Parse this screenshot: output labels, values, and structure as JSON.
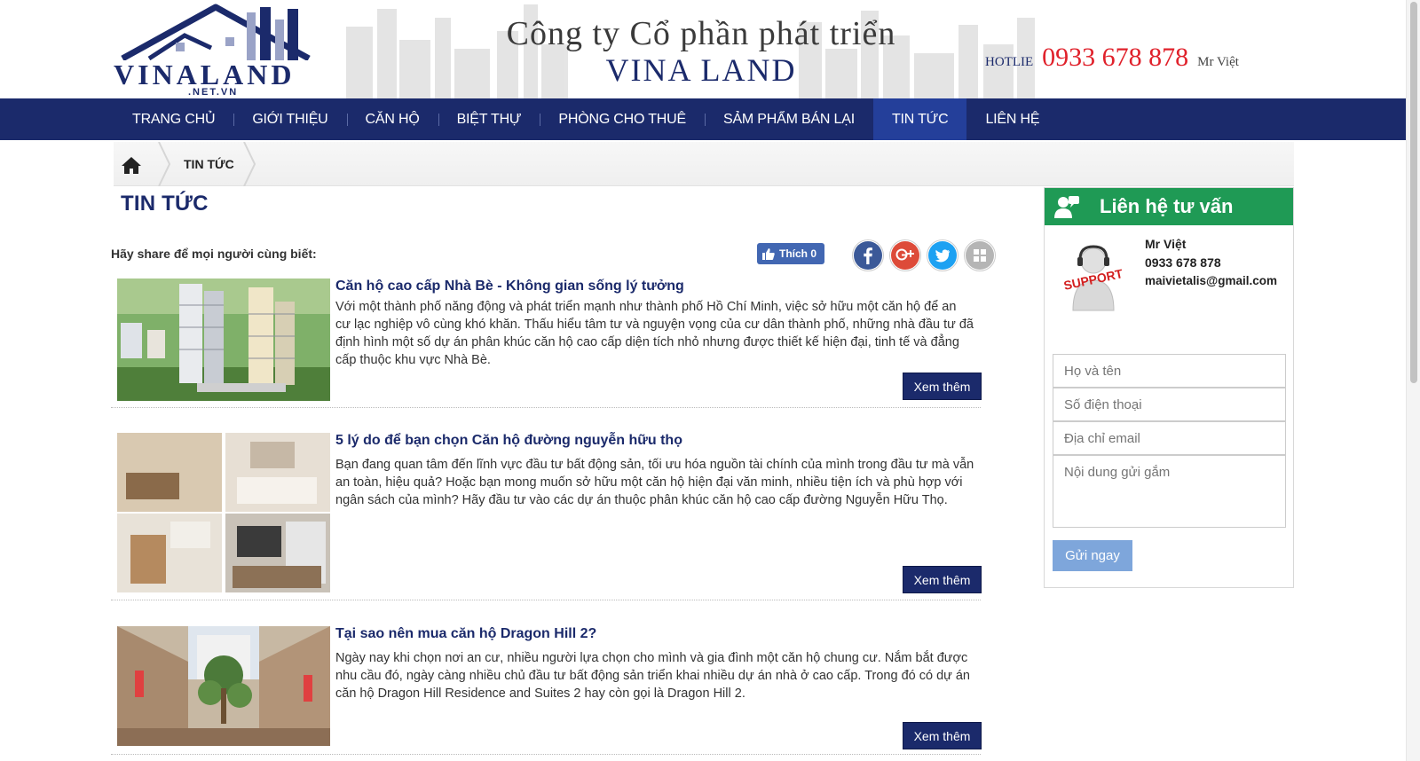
{
  "header": {
    "logo_brand": "VINALAND",
    "logo_sub": ".NET.VN",
    "company_line1": "Công ty Cổ phần phát triển",
    "company_line2": "VINA LAND",
    "hotline_label": "HOTLIE",
    "hotline_number": "0933 678 878",
    "hotline_name": "Mr Việt"
  },
  "nav": {
    "items": [
      {
        "label": "TRANG CHỦ"
      },
      {
        "label": "GIỚI THIỆU"
      },
      {
        "label": "CĂN HỘ"
      },
      {
        "label": "BIỆT THỰ"
      },
      {
        "label": "PHÒNG CHO THUÊ"
      },
      {
        "label": "SẢM PHẨM BÁN LẠI"
      },
      {
        "label": "TIN TỨC",
        "active": true
      },
      {
        "label": "LIÊN HỆ"
      }
    ]
  },
  "breadcrumb": {
    "home_icon": "home-icon",
    "current": "TIN TỨC"
  },
  "page_title": "TIN TỨC",
  "share": {
    "text": "Hãy share để mọi người cùng biết:",
    "like_label": "Thích 0",
    "icons": [
      "facebook-icon",
      "google-plus-icon",
      "twitter-icon",
      "share-icon"
    ]
  },
  "articles": [
    {
      "title": "Căn hộ cao cấp Nhà Bè - Không gian sống lý tưởng",
      "desc": "Với một thành phố năng động và phát triển mạnh như thành phố Hồ Chí Minh, việc sở hữu một căn hộ để an cư lạc nghiệp vô cùng khó khăn. Thấu hiểu tâm tư và nguyện vọng của cư dân thành phố, những nhà đầu tư đã định hình một số dự án phân khúc căn hộ cao cấp diện tích nhỏ nhưng được thiết kế hiện đại, tinh tế và đẳng cấp thuộc khu vực Nhà Bè.",
      "more": "Xem thêm"
    },
    {
      "title": "5 lý do để bạn chọn Căn hộ đường nguyễn hữu thọ",
      "desc": "Bạn đang quan tâm đến lĩnh vực đầu tư bất động sản, tối ưu hóa nguồn tài chính của mình trong đầu tư mà vẫn an toàn, hiệu quả? Hoặc bạn mong muốn sở hữu một căn hộ hiện đại văn minh, nhiều tiện ích và phù hợp với ngân sách của mình? Hãy đầu tư vào các dự án thuộc phân khúc căn hộ cao cấp đường Nguyễn Hữu Thọ.",
      "more": "Xem thêm"
    },
    {
      "title": "Tại sao nên mua căn hộ Dragon Hill 2?",
      "desc": "Ngày nay khi chọn nơi an cư, nhiều người lựa chọn cho mình và gia đình một căn hộ chung cư. Nắm bắt được nhu cầu đó, ngày càng nhiều chủ đầu tư bất động sản triển khai nhiều dự án nhà ở cao cấp. Trong đó có dự án căn hộ Dragon Hill Residence and Suites 2 hay còn gọi là Dragon Hill 2.",
      "more": "Xem thêm"
    }
  ],
  "sidebar": {
    "title": "Liên hệ tư vấn",
    "support_label": "SUPPORT",
    "contact_name": "Mr Việt",
    "contact_phone": "0933 678 878",
    "contact_email": "maivietalis@gmail.com",
    "placeholders": {
      "name": "Họ và tên",
      "phone": "Số điện thoại",
      "email": "Địa chỉ email",
      "message": "Nội dung gửi gắm"
    },
    "submit_label": "Gửi ngay"
  },
  "colors": {
    "navy": "#1b2a6b",
    "nav_active": "#243f9a",
    "hotline_red": "#e0212b",
    "sidebar_green": "#1f9a55",
    "submit_blue": "#7ea6db"
  }
}
